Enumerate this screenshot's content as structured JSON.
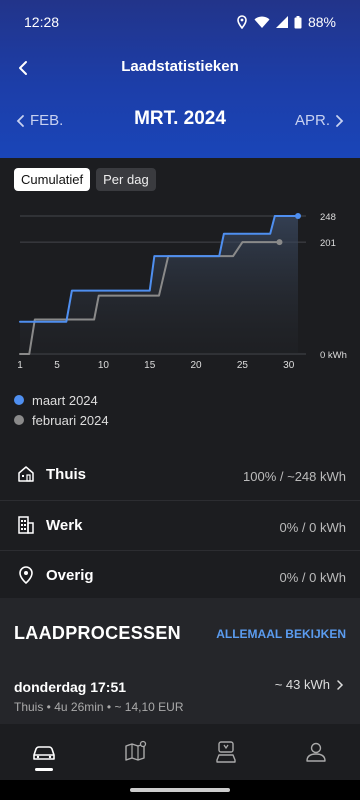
{
  "status": {
    "time": "12:28",
    "battery": "88%"
  },
  "header": {
    "title": "Laadstatistieken"
  },
  "month_nav": {
    "prev": "FEB.",
    "current": "MRT. 2024",
    "next": "APR."
  },
  "toggle": {
    "cumulative": "Cumulatief",
    "per_day": "Per dag",
    "selected": "Cumulatief"
  },
  "colors": {
    "march": "#4f8ff0",
    "february": "#8a8a8a",
    "accent_link": "#5b9cf0"
  },
  "chart_data": {
    "type": "line",
    "x_ticks": [
      1,
      5,
      10,
      15,
      20,
      25,
      30
    ],
    "y_labels": [
      "248",
      "201",
      "0 kWh"
    ],
    "ylim": [
      0,
      248
    ],
    "xlim": [
      1,
      31
    ],
    "series": [
      {
        "name": "maart 2024",
        "points": [
          [
            1,
            58
          ],
          [
            5,
            58
          ],
          [
            6,
            58
          ],
          [
            6.6,
            114
          ],
          [
            15,
            114
          ],
          [
            15.5,
            176
          ],
          [
            22.5,
            176
          ],
          [
            23,
            216
          ],
          [
            28,
            216
          ],
          [
            28.5,
            248
          ],
          [
            31,
            248
          ]
        ]
      },
      {
        "name": "februari 2024",
        "points": [
          [
            1,
            0
          ],
          [
            2,
            0
          ],
          [
            2.6,
            62
          ],
          [
            9,
            62
          ],
          [
            9.5,
            105
          ],
          [
            16,
            105
          ],
          [
            17,
            176
          ],
          [
            24,
            176
          ],
          [
            25,
            201
          ],
          [
            29,
            201
          ]
        ]
      }
    ]
  },
  "legend": [
    {
      "label": "maart 2024"
    },
    {
      "label": "februari 2024"
    }
  ],
  "locations": [
    {
      "name": "Thuis",
      "value": "100% / ~248 kWh",
      "icon": "home-icon"
    },
    {
      "name": "Werk",
      "value": "0% / 0 kWh",
      "icon": "building-icon"
    },
    {
      "name": "Overig",
      "value": "0% / 0 kWh",
      "icon": "location-pin-icon"
    }
  ],
  "sessions": {
    "title": "LAADPROCESSEN",
    "view_all": "ALLEMAAL BEKIJKEN",
    "item": {
      "date": "donderdag 17:51",
      "kwh": "~ 43 kWh",
      "detail": "Thuis • 4u 26min • ~  14,10 EUR"
    }
  },
  "nav": [
    "car-icon",
    "map-icon",
    "charging-icon",
    "profile-icon"
  ]
}
